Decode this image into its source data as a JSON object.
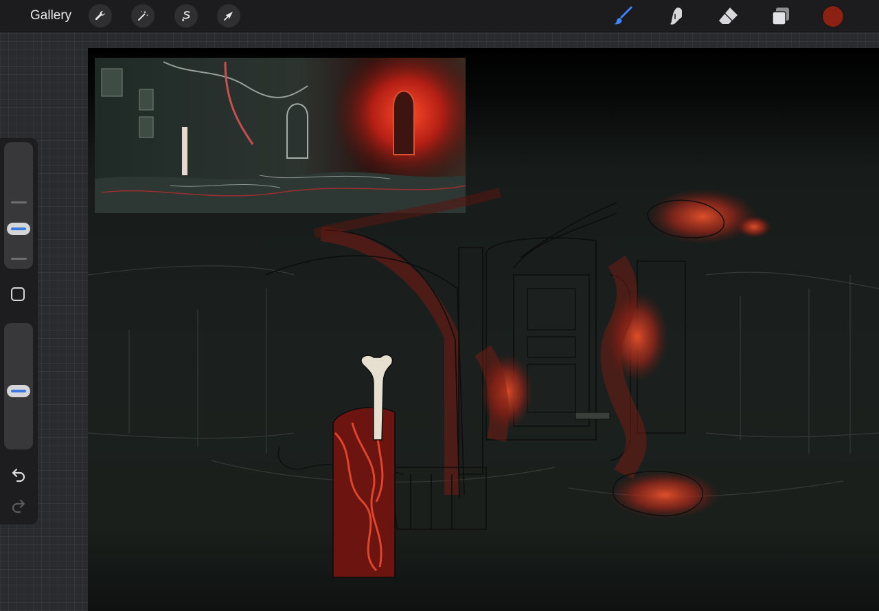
{
  "topbar": {
    "gallery_label": "Gallery",
    "left_tools": [
      {
        "name": "actions-wrench-icon"
      },
      {
        "name": "adjustments-magic-wand-icon"
      },
      {
        "name": "selection-icon"
      },
      {
        "name": "transform-arrow-icon"
      }
    ],
    "right_tools": [
      {
        "name": "brush-icon",
        "active": true,
        "color": "#3a86ff"
      },
      {
        "name": "smudge-icon"
      },
      {
        "name": "eraser-icon"
      },
      {
        "name": "layers-icon"
      }
    ],
    "current_color": "#8a2112"
  },
  "sidebar": {
    "brush_size_level": 0.6,
    "opacity_level": 0.25,
    "modify_button_icon": "square-icon",
    "undo_icon": "undo-icon",
    "redo_icon": "redo-icon"
  },
  "canvas": {
    "background_top": "#000000",
    "background_main": "#1b201e",
    "accent_red": "#b8301b"
  }
}
